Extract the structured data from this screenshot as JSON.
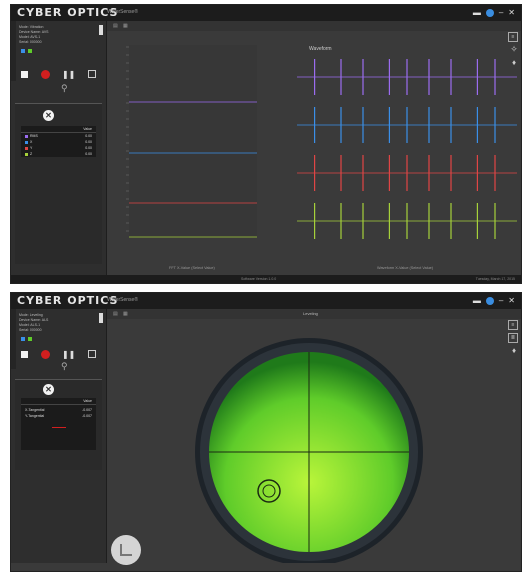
{
  "app": {
    "logo": "CYBER OPTICS",
    "logo_sub": "WaferSense®"
  },
  "win1": {
    "info_lines": [
      "Mode: Vibration",
      "Device Name: AVS",
      "Model: AVS-1",
      "Serial: 000000"
    ],
    "table": {
      "header": "Value",
      "rows": [
        {
          "name": "RMS",
          "value": "0.00",
          "color": "#9b6cf0"
        },
        {
          "name": "X",
          "value": "0.00",
          "color": "#3a8fe8"
        },
        {
          "name": "Y",
          "value": "0.00",
          "color": "#e04545"
        },
        {
          "name": "Z",
          "value": "0.00",
          "color": "#a6d13a"
        }
      ]
    },
    "right_title": "Waveform",
    "left_footer": "FFT X-Value (Select Value)",
    "right_footer": "Waveform X-Value (Select Value)",
    "status_center": "Software Version 1.0.0",
    "status_right": "Tuesday, March 17, 2015"
  },
  "win2": {
    "info_lines": [
      "Mode: Leveling",
      "Device Name: ALS",
      "Model: ALS-1",
      "Serial: 000000"
    ],
    "table": {
      "header": "Value",
      "rows": [
        {
          "name": "X-Tangential",
          "value": "-0.007"
        },
        {
          "name": "Y-Tangential",
          "value": "-0.007"
        }
      ]
    },
    "gauge_title": "Leveling"
  },
  "colors": {
    "purple": "#9b6cf0",
    "blue": "#3a8fe8",
    "red": "#e04545",
    "green": "#a6d13a",
    "level_green": "#5fcc2a"
  }
}
